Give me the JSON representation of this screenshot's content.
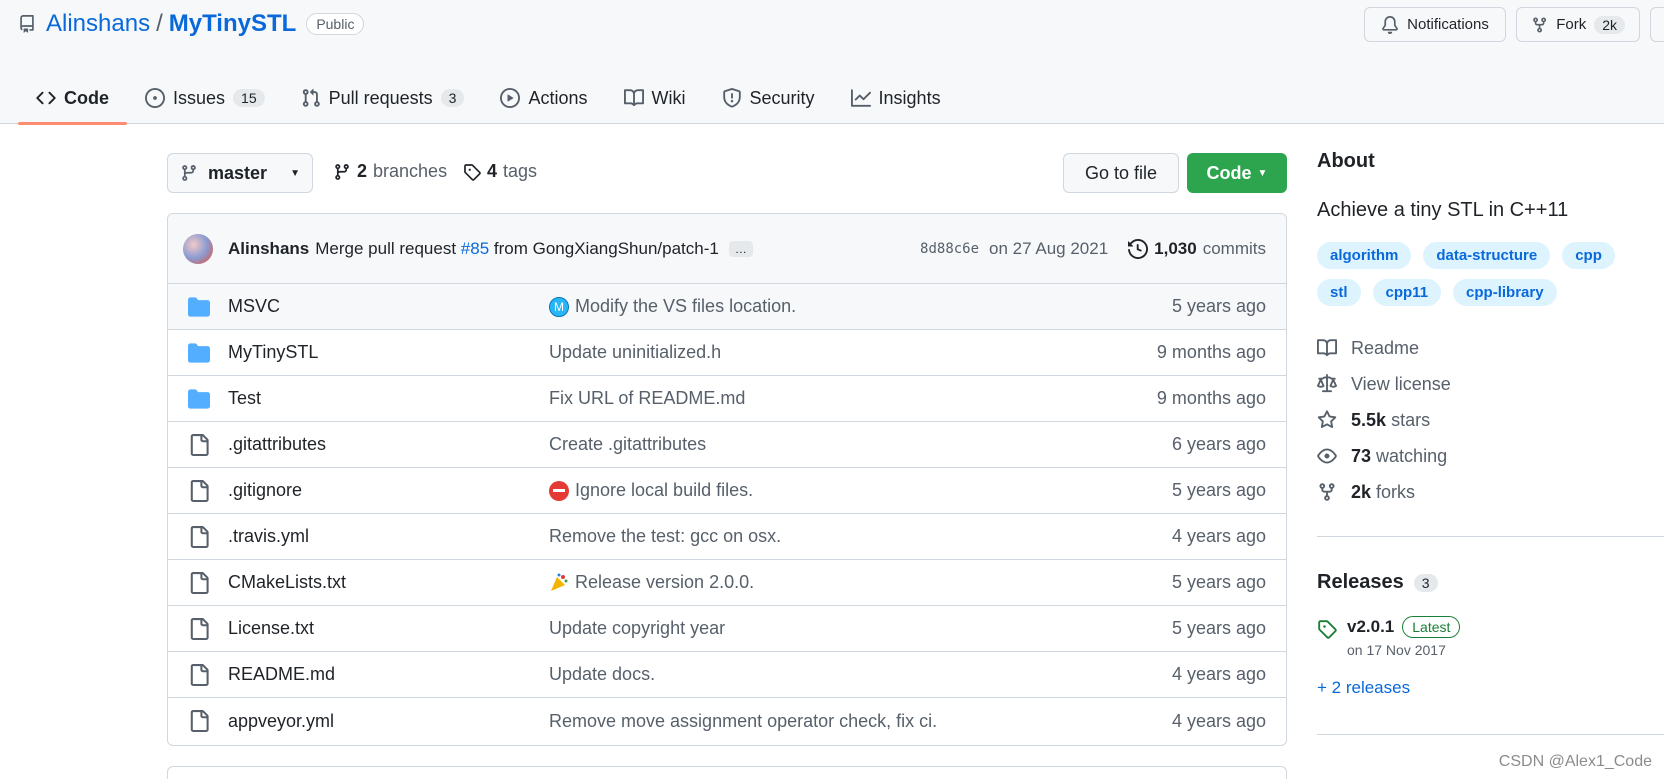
{
  "repo": {
    "owner": "Alinshans",
    "separator": "/",
    "name": "MyTinySTL",
    "visibility": "Public"
  },
  "header_actions": {
    "notifications": "Notifications",
    "fork_label": "Fork",
    "fork_count": "2k"
  },
  "tabs": [
    {
      "label": "Code",
      "icon": "code-icon",
      "count": ""
    },
    {
      "label": "Issues",
      "icon": "issue-icon",
      "count": "15"
    },
    {
      "label": "Pull requests",
      "icon": "pull-request-icon",
      "count": "3"
    },
    {
      "label": "Actions",
      "icon": "play-icon",
      "count": ""
    },
    {
      "label": "Wiki",
      "icon": "book-icon",
      "count": ""
    },
    {
      "label": "Security",
      "icon": "shield-icon",
      "count": ""
    },
    {
      "label": "Insights",
      "icon": "graph-icon",
      "count": ""
    }
  ],
  "branch": {
    "current": "master",
    "branches_count": "2",
    "branches_label": "branches",
    "tags_count": "4",
    "tags_label": "tags"
  },
  "buttons": {
    "go_to_file": "Go to file",
    "code": "Code"
  },
  "latest_commit": {
    "author": "Alinshans",
    "message_prefix": "Merge pull request",
    "pr": "#85",
    "message_suffix": "from GongXiangShun/patch-1",
    "ellipsis": "…",
    "sha": "8d88c6e",
    "date": "on 27 Aug 2021",
    "commits_count": "1,030",
    "commits_label": "commits"
  },
  "files": [
    {
      "type": "dir",
      "name": "MSVC",
      "message": "Modify the VS files location.",
      "emoji": "M",
      "age": "5 years ago"
    },
    {
      "type": "dir",
      "name": "MyTinySTL",
      "message": "Update uninitialized.h",
      "emoji": "",
      "age": "9 months ago"
    },
    {
      "type": "dir",
      "name": "Test",
      "message": "Fix URL of README.md",
      "emoji": "",
      "age": "9 months ago"
    },
    {
      "type": "file",
      "name": ".gitattributes",
      "message": "Create .gitattributes",
      "emoji": "",
      "age": "6 years ago"
    },
    {
      "type": "file",
      "name": ".gitignore",
      "message": "Ignore local build files.",
      "emoji": "no-entry",
      "age": "5 years ago"
    },
    {
      "type": "file",
      "name": ".travis.yml",
      "message": "Remove the test: gcc on osx.",
      "emoji": "",
      "age": "4 years ago"
    },
    {
      "type": "file",
      "name": "CMakeLists.txt",
      "message": "Release version 2.0.0.",
      "emoji": "tada",
      "age": "5 years ago"
    },
    {
      "type": "file",
      "name": "License.txt",
      "message": "Update copyright year",
      "emoji": "",
      "age": "5 years ago"
    },
    {
      "type": "file",
      "name": "README.md",
      "message": "Update docs.",
      "emoji": "",
      "age": "4 years ago"
    },
    {
      "type": "file",
      "name": "appveyor.yml",
      "message": "Remove move assignment operator check, fix ci.",
      "emoji": "",
      "age": "4 years ago"
    }
  ],
  "about": {
    "title": "About",
    "description": "Achieve a tiny STL in C++11",
    "topics": [
      "algorithm",
      "data-structure",
      "cpp",
      "stl",
      "cpp11",
      "cpp-library"
    ],
    "readme": "Readme",
    "license": "View license",
    "stars_count": "5.5k",
    "stars_label": "stars",
    "watching_count": "73",
    "watching_label": "watching",
    "forks_count": "2k",
    "forks_label": "forks"
  },
  "releases": {
    "title": "Releases",
    "count": "3",
    "latest_version": "v2.0.1",
    "latest_badge": "Latest",
    "latest_date": "on 17 Nov 2017",
    "more": "+ 2 releases"
  },
  "watermark": "CSDN @Alex1_Code",
  "colors": {
    "link": "#0969da",
    "primary_button": "#2da44e",
    "folder": "#54aeff",
    "tab_underline": "#fd8c73"
  }
}
